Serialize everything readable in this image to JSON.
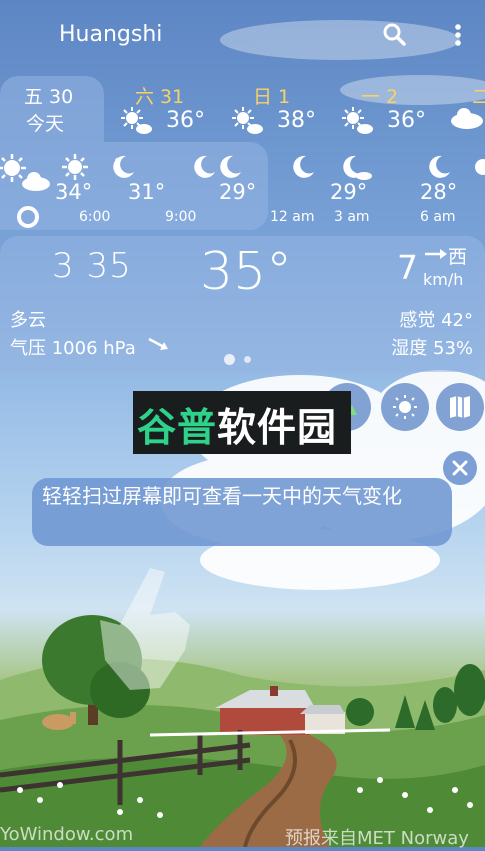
{
  "header": {
    "city": "Huangshi",
    "search_icon": "search-icon",
    "menu_icon": "more-vert-icon"
  },
  "days": [
    {
      "label": "五 30",
      "sub": "今天",
      "selected": true
    },
    {
      "label": "六 31",
      "temp": "36°",
      "icon": "sun-cloud-icon"
    },
    {
      "label": "日 1",
      "temp": "38°",
      "icon": "sun-cloud-icon"
    },
    {
      "label": "一 2",
      "temp": "36°",
      "icon": "sun-cloud-icon"
    },
    {
      "label": "二",
      "icon": "cloud-icon"
    }
  ],
  "hours": [
    {
      "temp": "",
      "time": "",
      "icon": "sun-cloud-icon"
    },
    {
      "temp": "34°",
      "time": "6:00",
      "icon": "sun-icon"
    },
    {
      "temp": "31°",
      "time": "9:00",
      "icon": "moon-icon"
    },
    {
      "temp": "29°",
      "time": "",
      "icon": "moon-icon"
    },
    {
      "temp": "",
      "time": "12 am",
      "icon": "moon-icon"
    },
    {
      "temp": "29°",
      "time": "3 am",
      "icon": "moon-icon"
    },
    {
      "temp": "28°",
      "time": "6 am",
      "icon": "moon-icon"
    },
    {
      "temp": "",
      "time": "",
      "icon": "sun-icon"
    }
  ],
  "current": {
    "time": "3 35",
    "temperature": "35°",
    "wind_speed": "7",
    "wind_direction": "西",
    "wind_unit": "km/h",
    "condition": "多云",
    "pressure": "气压 1006 hPa",
    "feels_like": "感觉 42°",
    "humidity": "湿度 53%",
    "page_dots": 2,
    "active_dot": 0
  },
  "actions": {
    "landscape_icon": "landscape-icon",
    "weather_radar_icon": "weather-radar-icon",
    "map_icon": "map-icon"
  },
  "watermark": {
    "text": "谷普软件园"
  },
  "hint": {
    "text": "轻轻扫过屏幕即可查看一天中的天气变化",
    "close_icon": "close-icon"
  },
  "footer": {
    "left": "YoWindow.com",
    "right": "预报来自MET Norway"
  },
  "colors": {
    "accent_day": "#f8d267",
    "panel": "#96b4e1",
    "watermark_green": "#2fd28a",
    "watermark_bg": "#1a1d1e"
  }
}
